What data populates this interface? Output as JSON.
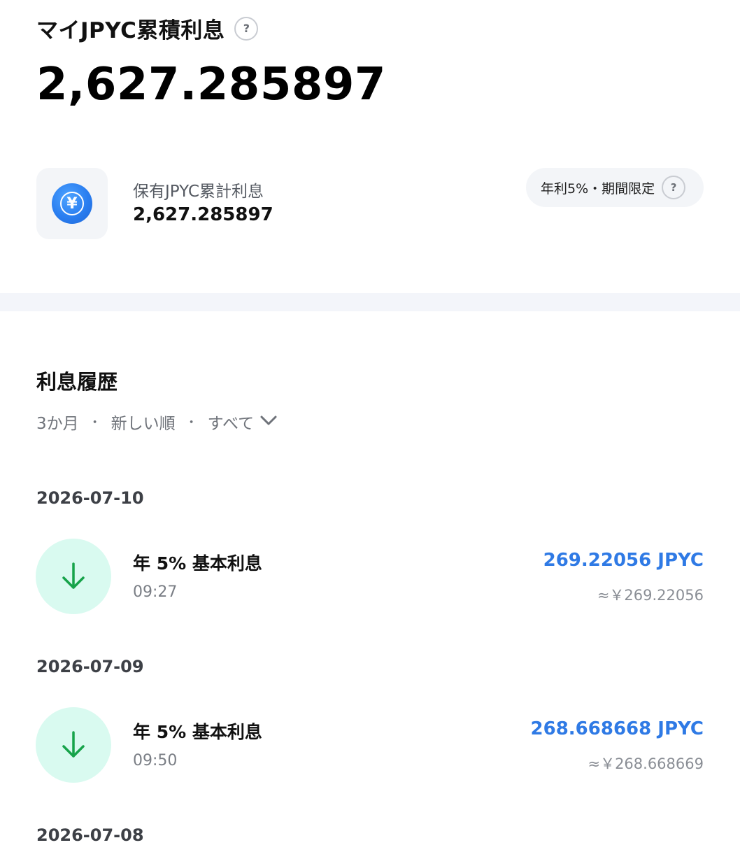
{
  "header": {
    "title": "マイJPYC累積利息",
    "help": "?",
    "total": "2,627.285897"
  },
  "holding": {
    "coin_symbol": "¥",
    "label": "保有JPYC累計利息",
    "value": "2,627.285897",
    "badge": "年利5%・期間限定",
    "badge_help": "?"
  },
  "history": {
    "title": "利息履歴",
    "filters": [
      "3か月",
      "新しい順",
      "すべて"
    ],
    "separator": "・",
    "groups": [
      {
        "date": "2026-07-10",
        "items": [
          {
            "title": "年 5% 基本利息",
            "time": "09:27",
            "amount": "269.22056 JPYC",
            "approx": "≈￥269.22056"
          }
        ]
      },
      {
        "date": "2026-07-09",
        "items": [
          {
            "title": "年 5% 基本利息",
            "time": "09:50",
            "amount": "268.668668 JPYC",
            "approx": "≈￥268.668669"
          }
        ]
      },
      {
        "date": "2026-07-08",
        "items": []
      }
    ]
  },
  "colors": {
    "accent_blue": "#2f7ae5",
    "icon_bg_green": "#d9faf0",
    "arrow_green": "#16a34a"
  }
}
